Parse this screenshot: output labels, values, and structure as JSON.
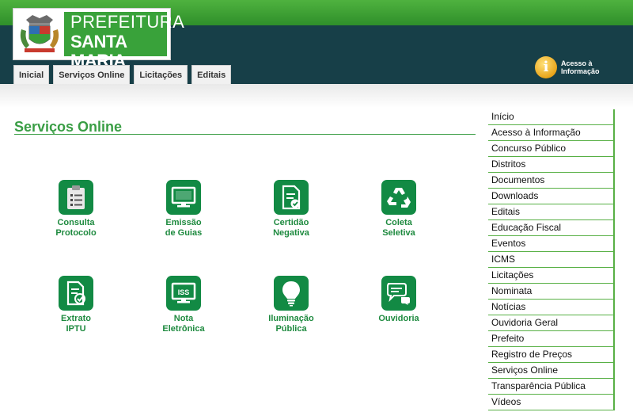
{
  "header": {
    "logo_line1": "PREFEITURA",
    "logo_line2": "SANTA MARIA",
    "tabs": [
      "Inicial",
      "Serviços Online",
      "Licitações",
      "Editais"
    ],
    "access_icon": "i",
    "access_label_line1": "Acesso à",
    "access_label_line2": "Informação"
  },
  "main": {
    "title": "Serviços Online",
    "services": [
      {
        "line1": "Consulta",
        "line2": "Protocolo",
        "icon": "clipboard-icon"
      },
      {
        "line1": "Emissão",
        "line2": "de Guias",
        "icon": "monitor-icon"
      },
      {
        "line1": "Certidão",
        "line2": "Negativa",
        "icon": "certificate-icon"
      },
      {
        "line1": "Coleta",
        "line2": "Seletiva",
        "icon": "recycle-icon"
      },
      {
        "line1": "Extrato",
        "line2": "IPTU",
        "icon": "document-check-icon"
      },
      {
        "line1": "Nota",
        "line2": "Eletrônica",
        "icon": "iss-monitor-icon"
      },
      {
        "line1": "Iluminação",
        "line2": "Pública",
        "icon": "lightbulb-icon"
      },
      {
        "line1": "Ouvidoria",
        "line2": "",
        "icon": "speech-bubbles-icon"
      }
    ],
    "iss_text": "ISS"
  },
  "sidebar": {
    "items": [
      "Início",
      "Acesso à Informação",
      "Concurso Público",
      "Distritos",
      "Documentos",
      "Downloads",
      "Editais",
      "Educação Fiscal",
      "Eventos",
      "ICMS",
      "Licitações",
      "Nominata",
      "Notícias",
      "Ouvidoria Geral",
      "Prefeito",
      "Registro de Preços",
      "Serviços Online",
      "Transparência Pública",
      "Vídeos"
    ]
  },
  "colors": {
    "top_green": "#3a9e35",
    "header_dark": "#173f48",
    "brand_green": "#39a23a",
    "icon_green": "#128a44",
    "title_green": "#3a9e45"
  }
}
